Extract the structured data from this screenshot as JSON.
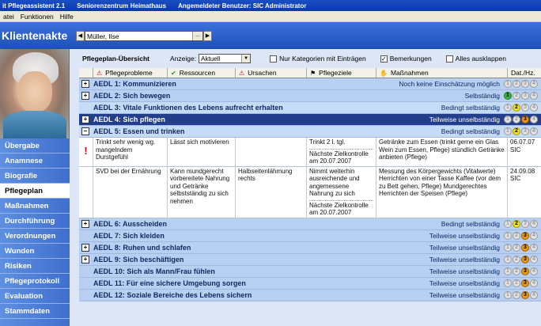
{
  "title": {
    "app": "it Pflegeassistent 2.1",
    "facility": "Seniorenzentrum Heimathaus",
    "user": "Angemeldeter Benutzer: SIC Administrator"
  },
  "menu": [
    "atei",
    "Funktionen",
    "Hilfe"
  ],
  "kbar": {
    "title": "Klientenakte",
    "client": "Müller, Ilse",
    "ellipsis": "..."
  },
  "sidebar": [
    "Übergabe",
    "Anamnese",
    "Biografie",
    "Pflegeplan",
    "Maßnahmen",
    "Durchführung",
    "Verordnungen",
    "Wunden",
    "Risiken",
    "Pflegeprotokoll",
    "Evaluation",
    "Stammdaten"
  ],
  "toolbar": {
    "title": "Pflegeplan-Übersicht",
    "anzeige_label": "Anzeige:",
    "anzeige_value": "Aktuell",
    "cb1": "Nur Kategorien mit Einträgen",
    "cb2": "Bemerkungen",
    "cb3": "Alles ausklappen"
  },
  "columns": [
    "Pflegeprobleme",
    "Ressourcen",
    "Ursachen",
    "Pflegeziele",
    "Maßnahmen",
    "Dat./Hz."
  ],
  "rows": [
    {
      "title": "AEDL 1: Kommunizieren",
      "status": "Noch keine Einschätzung möglich",
      "level": 0
    },
    {
      "title": "AEDL 2: Sich bewegen",
      "status": "Selbständig",
      "level": 1
    },
    {
      "title": "AEDL 3: Vitale Funktionen des Lebens aufrecht erhalten",
      "status": "Bedingt selbständig",
      "level": 2
    },
    {
      "title": "AEDL 4: Sich pflegen",
      "status": "Teilweise unselbständig",
      "level": 3
    },
    {
      "title": "AEDL 5: Essen und trinken",
      "status": "Bedingt selbständig",
      "level": 2
    },
    {
      "title": "AEDL 6: Ausscheiden",
      "status": "Bedingt selbständig",
      "level": 2
    },
    {
      "title": "AEDL 7: Sich kleiden",
      "status": "Teilweise unselbständig",
      "level": 3
    },
    {
      "title": "AEDL 8: Ruhen und schlafen",
      "status": "Teilweise unselbständig",
      "level": 3
    },
    {
      "title": "AEDL 9: Sich beschäftigen",
      "status": "Teilweise unselbständig",
      "level": 3
    },
    {
      "title": "AEDL 10: Sich als Mann/Frau fühlen",
      "status": "Teilweise unselbständig",
      "level": 3
    },
    {
      "title": "AEDL 11: Für eine sichere Umgebung sorgen",
      "status": "Teilweise unselbständig",
      "level": 3
    },
    {
      "title": "AEDL 12: Soziale Bereiche des Lebens sichern",
      "status": "Teilweise unselbständig",
      "level": 3
    }
  ],
  "details": [
    {
      "problem": "Trinkt sehr wenig wg. mangelndem Durstgefühl",
      "ressource": "Lässt sich motivieren",
      "ursache": "",
      "ziel": "Trinkt 2 l. tgl.",
      "kontrolle": "Nächste Zielkontrolle am 20.07.2007",
      "massnahme": "Getränke zum Essen (trinkt gerne ein Glas Wein zum Essen, Pflege) stündlich Getränke anbieten (Pflege)",
      "datum": "06.07.07",
      "hz": "SIC"
    },
    {
      "problem": "SVD bei der Ernährung",
      "ressource": "Kann mundgerecht vorbereitete Nahrung und Getränke selbstständig zu sich nehmen",
      "ursache": "Halbseitenlähmung rechts",
      "ziel": "Nimmt weiterhin ausreichende und angemessene Nahrung zu sich",
      "kontrolle": "Nächste Zielkontrolle am 20.07.2007",
      "massnahme": "Messung des Körpergewichts (Vitalwerte) Herrichten von einer Tasse Kaffee (vor dem zu Bett gehen, Pflege) Mundgerechtes Herrichten der Speisen (Pflege)",
      "datum": "24.09.08",
      "hz": "SIC"
    }
  ]
}
